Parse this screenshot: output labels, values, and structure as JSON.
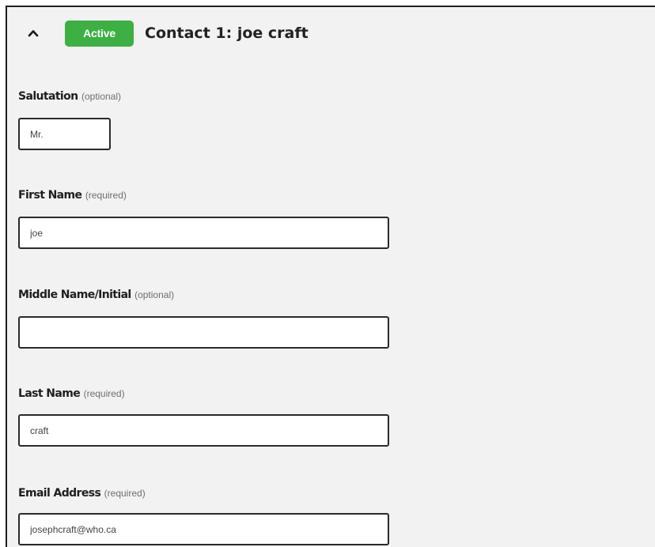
{
  "contact": {
    "status_badge": "Active",
    "title": "Contact 1: joe craft",
    "collapse_icon": "chevron-up-icon"
  },
  "fields": {
    "salutation": {
      "label": "Salutation",
      "hint": "(optional)",
      "value": "Mr."
    },
    "first_name": {
      "label": "First Name",
      "hint": "(required)",
      "value": "joe"
    },
    "middle_name": {
      "label": "Middle Name/Initial",
      "hint": "(optional)",
      "value": ""
    },
    "last_name": {
      "label": "Last Name",
      "hint": "(required)",
      "value": "craft"
    },
    "email": {
      "label": "Email Address",
      "hint": "(required)",
      "value": "josephcraft@who.ca"
    }
  },
  "colors": {
    "badge_green": "#3cb043",
    "panel_background": "#f2f2f2",
    "border": "#2a2a2a"
  }
}
